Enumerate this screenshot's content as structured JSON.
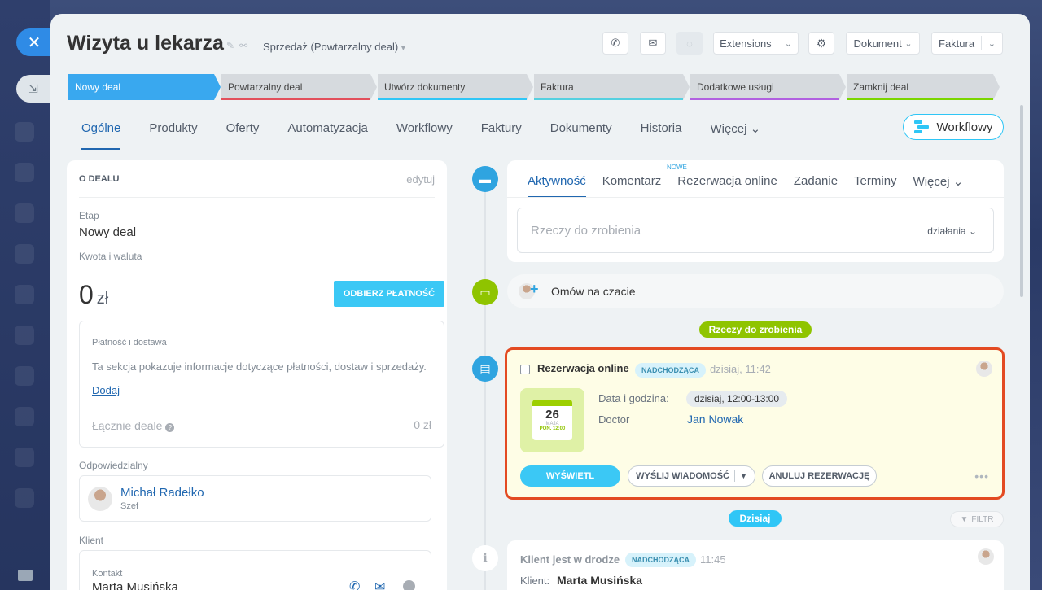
{
  "header": {
    "title": "Wizyta u lekarza",
    "pipeline": "Sprzedaż (Powtarzalny deal)",
    "extensions_label": "Extensions",
    "document_label": "Dokument",
    "invoice_label": "Faktura"
  },
  "stages": [
    {
      "label": "Nowy deal",
      "color": "#39a8ef",
      "underline": "#39a8ef",
      "active": true
    },
    {
      "label": "Powtarzalny deal",
      "color": "#d6dade",
      "underline": "#e2505c"
    },
    {
      "label": "Utwórz dokumenty",
      "color": "#d6dade",
      "underline": "#2fc6f6"
    },
    {
      "label": "Faktura",
      "color": "#d6dade",
      "underline": "#55d0e0"
    },
    {
      "label": "Dodatkowe usługi",
      "color": "#d6dade",
      "underline": "#b160e0"
    },
    {
      "label": "Zamknij deal",
      "color": "#d6dade",
      "underline": "#7bd500"
    }
  ],
  "tabs": [
    {
      "label": "Ogólne",
      "active": true
    },
    {
      "label": "Produkty"
    },
    {
      "label": "Oferty"
    },
    {
      "label": "Automatyzacja"
    },
    {
      "label": "Workflowy"
    },
    {
      "label": "Faktury"
    },
    {
      "label": "Dokumenty"
    },
    {
      "label": "Historia"
    },
    {
      "label": "Więcej ⌄"
    }
  ],
  "workflow_button": "Workflowy",
  "about": {
    "heading": "O DEALU",
    "edit": "edytuj",
    "stage_label": "Etap",
    "stage_value": "Nowy deal",
    "amount_label": "Kwota i waluta",
    "amount_value": "0",
    "currency": "zł",
    "pay_button": "ODBIERZ PŁATNOŚĆ",
    "payment_title": "Płatność i dostawa",
    "payment_desc": "Ta sekcja pokazuje informacje dotyczące płatności, dostaw i sprzedaży.",
    "add_link": "Dodaj",
    "total_label": "Łącznie deale",
    "total_value": "0 zł",
    "responsible_label": "Odpowiedzialny",
    "responsible_name": "Michał Radełko",
    "responsible_role": "Szef",
    "client_label": "Klient",
    "contact_label": "Kontakt",
    "contact_name": "Marta Musińska"
  },
  "activity": {
    "tabs": [
      "Aktywność",
      "Komentarz",
      "Rezerwacja online",
      "Zadanie",
      "Terminy",
      "Więcej ⌄"
    ],
    "new_tag": "NOWE",
    "todo_placeholder": "Rzeczy do zrobienia",
    "actions_label": "działania"
  },
  "chat": {
    "label": "Omów na czacie"
  },
  "todo_pill": "Rzeczy do zrobienia",
  "booking": {
    "title": "Rezerwacja online",
    "badge": "NADCHODZĄCA",
    "time": "dzisiaj, 11:42",
    "date_label": "Data i godzina:",
    "date_value": "dzisiaj, 12:00-13:00",
    "doctor_label": "Doctor",
    "doctor_value": "Jan Nowak",
    "cal_day": "26",
    "cal_month": "MAJA",
    "cal_time": "PON. 12:00",
    "btn_view": "WYŚWIETL",
    "btn_message": "WYŚLIJ WIADOMOŚĆ",
    "btn_cancel": "ANULUJ REZERWACJĘ"
  },
  "today_pill": "Dzisiaj",
  "filter_label": "FILTR",
  "client_event": {
    "title": "Klient jest w drodze",
    "badge": "NADCHODZĄCA",
    "time": "11:45",
    "client_label": "Klient:",
    "client_name": "Marta Musińska"
  },
  "colors": {
    "accent": "#2067b0",
    "primary_button": "#3bc8f5",
    "timeline_blue": "#2fa4e0",
    "timeline_green": "#8fc400",
    "highlight_border": "#e34a22"
  }
}
